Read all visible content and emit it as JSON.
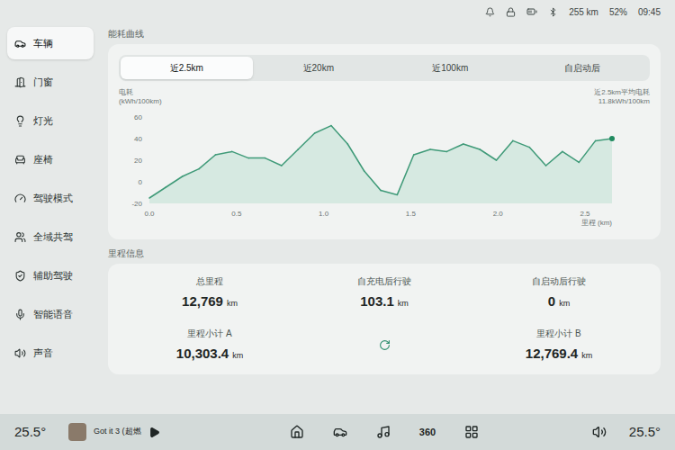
{
  "status_bar": {
    "range": "255 km",
    "battery": "52%",
    "time": "09:45"
  },
  "sidebar": {
    "items": [
      {
        "label": "车辆",
        "selected": true
      },
      {
        "label": "门窗",
        "selected": false
      },
      {
        "label": "灯光",
        "selected": false
      },
      {
        "label": "座椅",
        "selected": false
      },
      {
        "label": "驾驶模式",
        "selected": false
      },
      {
        "label": "全域共驾",
        "selected": false
      },
      {
        "label": "辅助驾驶",
        "selected": false
      },
      {
        "label": "智能语音",
        "selected": false
      },
      {
        "label": "声音",
        "selected": false
      }
    ]
  },
  "energy": {
    "title": "能耗曲线",
    "tabs": [
      {
        "label": "近2.5km",
        "selected": true
      },
      {
        "label": "近20km",
        "selected": false
      },
      {
        "label": "近100km",
        "selected": false
      },
      {
        "label": "自启动后",
        "selected": false
      }
    ],
    "chart": {
      "y_title": "电耗",
      "y_unit": "(kWh/100km)",
      "average_label": "近2.5km平均电耗",
      "average_value": "11.8kWh/100km",
      "y_ticks": [
        "60",
        "40",
        "20",
        "0",
        "-20"
      ],
      "x_ticks": [
        "0.0",
        "0.5",
        "1.0",
        "1.5",
        "2.0",
        "2.5"
      ],
      "x_label": "里程 (km)",
      "series": [
        -15,
        -5,
        5,
        12,
        25,
        28,
        22,
        22,
        15,
        30,
        45,
        52,
        35,
        10,
        -8,
        -12,
        25,
        30,
        28,
        35,
        30,
        20,
        38,
        32,
        15,
        28,
        18,
        38,
        40
      ]
    }
  },
  "mileage": {
    "title": "里程信息",
    "stats": [
      {
        "label": "总里程",
        "value": "12,769",
        "unit": "km"
      },
      {
        "label": "自充电后行驶",
        "value": "103.1",
        "unit": "km"
      },
      {
        "label": "自启动后行驶",
        "value": "0",
        "unit": "km"
      }
    ],
    "trips": [
      {
        "label": "里程小计 A",
        "value": "10,303.4",
        "unit": "km"
      },
      {
        "label": "里程小计 B",
        "value": "12,769.4",
        "unit": "km"
      }
    ]
  },
  "dock": {
    "left_temp": "25.5°",
    "song_title": "Got it 3 (超燃",
    "view_360": "360",
    "right_temp": "25.5°"
  }
}
